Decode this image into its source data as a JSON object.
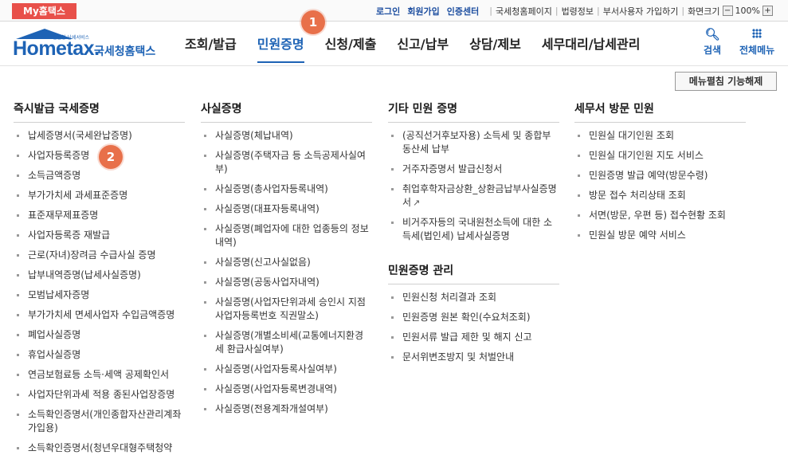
{
  "topbar": {
    "my_home": "My홈택스",
    "links_strong": [
      "로그인",
      "회원가입",
      "인증센터"
    ],
    "links": [
      "국세청홈페이지",
      "법령정보",
      "부서사용자 가입하기"
    ],
    "zoom_label": "화면크기",
    "zoom_minus": "−",
    "zoom_value": "100%",
    "zoom_plus": "+"
  },
  "logo": {
    "small": "민원형 납세서비스",
    "word": "Hometax.",
    "kr": "국세청홈택스"
  },
  "gnb": [
    "조회/발급",
    "민원증명",
    "신청/제출",
    "신고/납부",
    "상담/제보",
    "세무대리/납세관리"
  ],
  "header_buttons": {
    "search": "검색",
    "all_menu": "전체메뉴"
  },
  "badges": {
    "one": "1",
    "two": "2"
  },
  "collapse_button": "메뉴펼침 기능해제",
  "columns": [
    {
      "title": "즉시발급 국세증명",
      "items": [
        "납세증명서(국세완납증명)",
        "사업자등록증명",
        "소득금액증명",
        "부가가치세 과세표준증명",
        "표준재무제표증명",
        "사업자등록증 재발급",
        "근로(자녀)장려금 수급사실 증명",
        "납부내역증명(납세사실증명)",
        "모범납세자증명",
        "부가가치세 면세사업자 수입금액증명",
        "폐업사실증명",
        "휴업사실증명",
        "연금보험료등 소득·세액 공제확인서",
        "사업자단위과세 적용 종된사업장증명",
        "소득확인증명서(개인종합자산관리계좌 가입용)",
        "소득확인증명서(청년우대형주택청약"
      ]
    },
    {
      "title": "사실증명",
      "items": [
        "사실증명(체납내역)",
        "사실증명(주택자금 등 소득공제사실여부)",
        "사실증명(총사업자등록내역)",
        "사실증명(대표자등록내역)",
        "사실증명(폐업자에 대한 업종등의 정보내역)",
        "사실증명(신고사실없음)",
        "사실증명(공동사업자내역)",
        "사실증명(사업자단위과세 승인시 지점사업자등록번호 직권말소)",
        "사실증명(개별소비세(교통에너지환경세 환급사실여부)",
        "사실증명(사업자등록사실여부)",
        "사실증명(사업자등록변경내역)",
        "사실증명(전용계좌개설여부)"
      ]
    },
    {
      "title": "기타 민원 증명",
      "items": [
        "(공직선거후보자용) 소득세 및 종합부동산세 납부",
        "거주자증명서 발급신청서",
        "취업후학자금상환_상환금납부사실증명서",
        "비거주자등의 국내원천소득에 대한 소득세(법인세) 납세사실증명"
      ],
      "sub_title": "민원증명 관리",
      "sub_items": [
        "민원신청 처리결과 조회",
        "민원증명 원본 확인(수요처조회)",
        "민원서류 발급 제한 및 해지 신고",
        "문서위변조방지 및 처벌안내"
      ]
    },
    {
      "title": "세무서 방문 민원",
      "items": [
        "민원실 대기인원 조회",
        "민원실 대기인원 지도 서비스",
        "민원증명 발급 예약(방문수령)",
        "방문 접수 처리상태 조회",
        "서면(방문, 우편 등) 접수현황 조회",
        "민원실 방문 예약 서비스"
      ]
    }
  ]
}
